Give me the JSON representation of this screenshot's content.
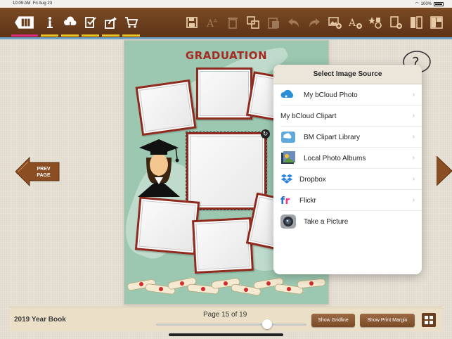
{
  "status_bar": {
    "time": "10:09 AM",
    "date": "Fri Aug 23",
    "battery": "100%"
  },
  "toolbar": {
    "left_tools": [
      {
        "name": "back-book-icon"
      },
      {
        "name": "info-icon",
        "accent": "#f2c020"
      },
      {
        "name": "cloud-sync-icon",
        "accent": "#f2c020"
      },
      {
        "name": "check-list-icon",
        "accent": "#f2c020"
      },
      {
        "name": "share-icon",
        "accent": "#f2c020"
      },
      {
        "name": "cart-icon",
        "accent": "#f2c020"
      }
    ],
    "right_tools": [
      "save-icon",
      "font-size-icon",
      "delete-icon",
      "copy-icon",
      "paste-icon",
      "undo-icon",
      "redo-icon",
      "add-image-icon",
      "add-text-icon",
      "clipart-icon",
      "add-page-icon",
      "duplicate-page-icon",
      "layout-icon"
    ]
  },
  "page": {
    "title": "GRADUATION",
    "background": "#9cc8b1"
  },
  "nav": {
    "prev_label_line1": "PREV",
    "prev_label_line2": "PAGE"
  },
  "popover": {
    "title": "Select Image Source",
    "items": [
      {
        "label": "My bCloud Photo",
        "icon": "bcloud-icon",
        "chevron": true
      },
      {
        "label": "My bCloud Clipart",
        "icon": "",
        "chevron": true
      },
      {
        "label": "BM Clipart Library",
        "icon": "clipart-library-icon",
        "chevron": true
      },
      {
        "label": "Local Photo Albums",
        "icon": "photo-albums-icon",
        "chevron": true
      },
      {
        "label": "Dropbox",
        "icon": "dropbox-icon",
        "chevron": true
      },
      {
        "label": "Flickr",
        "icon": "flickr-icon",
        "chevron": true
      },
      {
        "label": "Take a Picture",
        "icon": "camera-icon",
        "chevron": false
      }
    ]
  },
  "bottom_bar": {
    "book_title": "2019 Year Book",
    "page_info": "Page 15 of 19",
    "slider_fraction": 0.737,
    "show_gridline": "Show Gridline",
    "show_print_margin": "Show Print Margin"
  },
  "colors": {
    "toolbar": "#6b3d1c",
    "accent_frame": "#8e2a1e",
    "title": "#a42a22",
    "active_underline": "#f2c020",
    "pink_underline": "#e0297a"
  }
}
